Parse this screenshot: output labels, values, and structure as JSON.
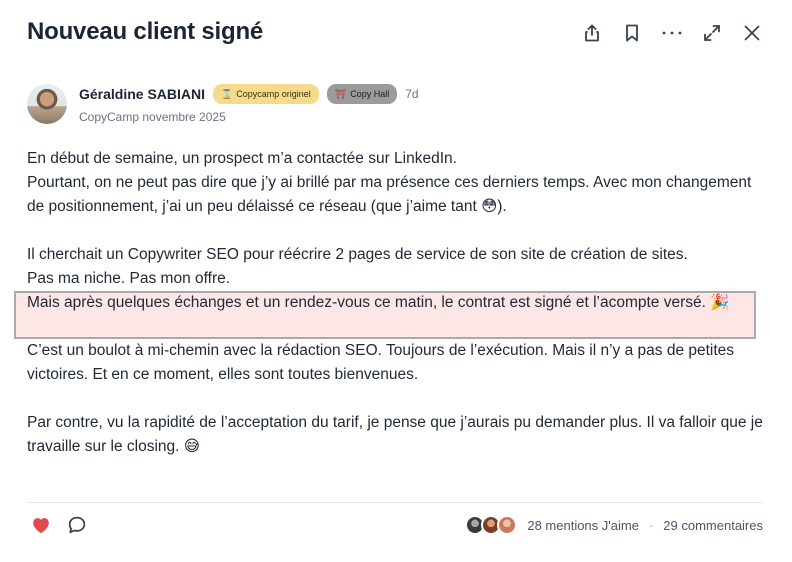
{
  "post": {
    "title": "Nouveau client signé",
    "author": "Géraldine SABIANI",
    "badges": [
      {
        "icon": "⌛",
        "label": "Copycamp originel"
      },
      {
        "icon": "⛩",
        "label": "Copy Hall"
      }
    ],
    "age": "7d",
    "space": "CopyCamp novembre 2025",
    "paragraphs": {
      "p1": "En début de semaine, un prospect m’a contactée sur LinkedIn.",
      "p2": "Pourtant, on ne peut pas dire que j’y ai brillé par ma présence ces derniers temps. Avec mon changement de positionnement, j’ai un peu délaissé ce réseau (que j’aime tant 😳).",
      "p3": "Il cherchait un Copywriter SEO pour réécrire 2 pages de service de son site de création de sites.",
      "p4": "Pas ma niche. Pas mon offre.",
      "p5": "Mais après quelques échanges et un rendez-vous ce matin, le contrat est signé et l’acompte versé. 🎉",
      "p6": "C’est un boulot à mi-chemin avec la rédaction SEO. Toujours de l’exécution. Mais il n’y a pas de petites victoires. Et en ce moment, elles sont toutes bienvenues.",
      "p7": "Par contre, vu la rapidité de l’acceptation du tarif, je pense que j’aurais pu demander plus. Il va falloir que je travaille sur le closing. 😅"
    },
    "likes": "28 mentions J'aime",
    "separator": "·",
    "comments": "29 commentaires"
  },
  "icons": {
    "share": "share-icon",
    "bookmark": "bookmark-icon",
    "more": "more-icon",
    "expand": "expand-icon",
    "close": "close-icon",
    "like": "heart-icon",
    "comment": "comment-icon"
  },
  "colors": {
    "like": "#e5484d",
    "highlight_bg": "#fce6e6",
    "highlight_border": "#a9a9a9",
    "badge_gold": "#f6dc8a",
    "badge_grey": "#9b9b9b"
  }
}
